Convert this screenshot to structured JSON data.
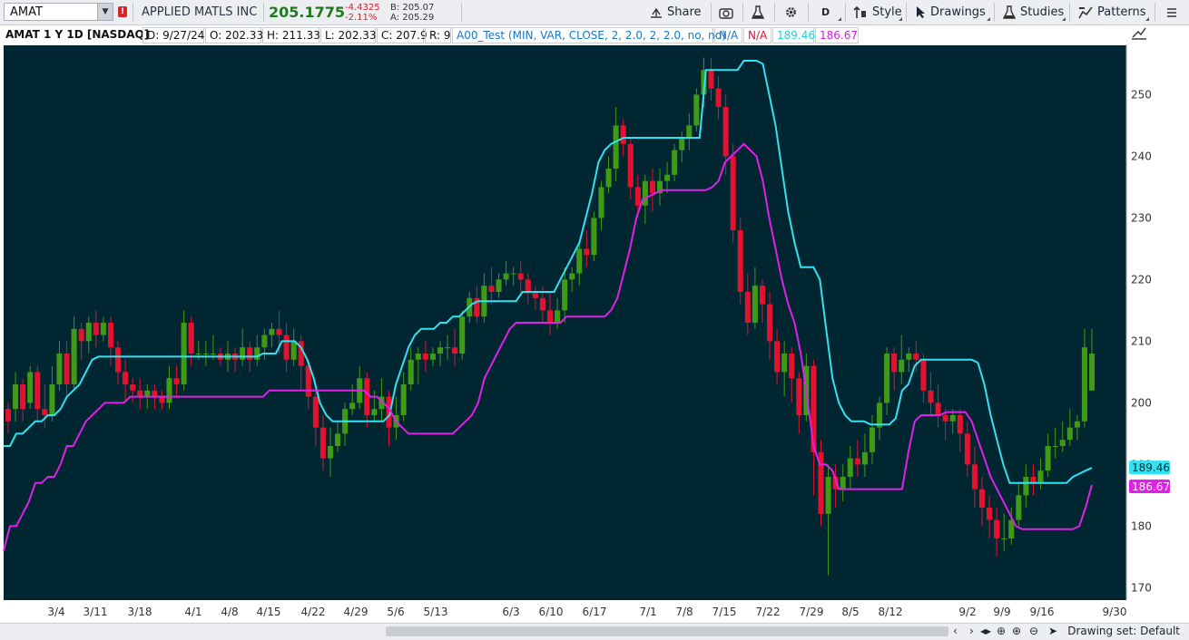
{
  "toolbar": {
    "symbol": "AMAT",
    "alert_badge": "!",
    "company": "APPLIED MATLS INC",
    "last_price": "205.1775",
    "change": "-4.4325",
    "change_pct": "-2.11%",
    "bid": "B: 205.07",
    "ask": "A: 205.29",
    "share_label": "Share",
    "aggregation_label": "D",
    "style_label": "Style",
    "drawings_label": "Drawings",
    "studies_label": "Studies",
    "patterns_label": "Patterns"
  },
  "header": {
    "title": "AMAT 1 Y 1D [NASDAQ]",
    "date": "D: 9/27/24",
    "open": "O: 202.33",
    "high": "H: 211.33",
    "low": "L: 202.33",
    "close": "C: 207.9",
    "range": "R: 9",
    "study": "A00_Test (MIN, VAR, CLOSE, 2, 2.0, 2, 2.0, no, no)",
    "val1": "N/A",
    "val2": "N/A",
    "val3": "189.46",
    "val4": "186.67"
  },
  "colors": {
    "background": "#002632",
    "up": "#3f9a16",
    "down": "#e4122f",
    "upper_line": "#33e1f0",
    "lower_line": "#e020e8",
    "axis_text": "#333333"
  },
  "chart_data": {
    "type": "candlestick",
    "ylim": [
      168,
      258
    ],
    "y_ticks": [
      170,
      180,
      190,
      200,
      210,
      220,
      230,
      240,
      250
    ],
    "x_tick_labels": [
      "3/4",
      "3/11",
      "3/18",
      "4/1",
      "4/8",
      "4/15",
      "4/22",
      "4/29",
      "5/6",
      "5/13",
      "6/3",
      "6/10",
      "6/17",
      "7/1",
      "7/8",
      "7/15",
      "7/22",
      "7/29",
      "8/5",
      "8/12",
      "9/2",
      "9/9",
      "9/16",
      "9/30"
    ],
    "price_labels": [
      189.46,
      186.67
    ],
    "upper_line": [
      193,
      193,
      195,
      195,
      196,
      197,
      197,
      198,
      198,
      199,
      201,
      202,
      203,
      205,
      207,
      207.5,
      207.5,
      207.5,
      207.5,
      207.5,
      207.5,
      207.5,
      207.5,
      207.5,
      207.5,
      207.5,
      207.5,
      207.5,
      207.5,
      207.5,
      207.5,
      207.5,
      207.5,
      207.5,
      207.5,
      207.5,
      207.5,
      207.5,
      207.5,
      207.5,
      207.5,
      208,
      208,
      208,
      210,
      210,
      210,
      209,
      207,
      204,
      200,
      198,
      197,
      197,
      197,
      197,
      197,
      197,
      197,
      197,
      197,
      198,
      203,
      206,
      209,
      211,
      212,
      212,
      212,
      213,
      213,
      214,
      214,
      215,
      216,
      216.5,
      216.5,
      216.5,
      216.5,
      216.5,
      216.5,
      216.5,
      218,
      218,
      218,
      218,
      218,
      218,
      220,
      222,
      224,
      226,
      230,
      234,
      239,
      241,
      242,
      242.5,
      243,
      243,
      243,
      243,
      243,
      243,
      243,
      243,
      243,
      243,
      243,
      243,
      243,
      254,
      254,
      254,
      254,
      254,
      254,
      255.5,
      255.5,
      255.5,
      255,
      250,
      245,
      238,
      231,
      226,
      222,
      222,
      222,
      220,
      212,
      204,
      200,
      198,
      197,
      197,
      197,
      196.5,
      196.5,
      196.5,
      196.5,
      197.5,
      202,
      203,
      206,
      207,
      207,
      207,
      207,
      207,
      207,
      207,
      207,
      207,
      206.5,
      203,
      198,
      194,
      190,
      187,
      187,
      187,
      187,
      187,
      187,
      187,
      187,
      187,
      187,
      188,
      188.5,
      189,
      189.46
    ],
    "lower_line": [
      176,
      180,
      180,
      182,
      184,
      187,
      187,
      188,
      188,
      190,
      193,
      193,
      195,
      197,
      198,
      199,
      200,
      200,
      200,
      200,
      201,
      201,
      201,
      201,
      201,
      201,
      201,
      201,
      201,
      201,
      201,
      201,
      201,
      201,
      201,
      201,
      201,
      201,
      201,
      201,
      201,
      201,
      202,
      202,
      202,
      202,
      202,
      202,
      202,
      202,
      202,
      202,
      202,
      202,
      202,
      202,
      202,
      202,
      201,
      201,
      200,
      199,
      197,
      196,
      195,
      195,
      195,
      195,
      195,
      195,
      195,
      195,
      196,
      197,
      198,
      200,
      204,
      206,
      208,
      210,
      212,
      213,
      213,
      213,
      213,
      213,
      213,
      213,
      213,
      214,
      214,
      214,
      214,
      214,
      214,
      214,
      215,
      217,
      221,
      225,
      230,
      233,
      233.5,
      234,
      234.5,
      234.5,
      234.5,
      234.5,
      234.5,
      234.5,
      234.5,
      234.5,
      235,
      236,
      239,
      240,
      241,
      242,
      241,
      240,
      236,
      230,
      225,
      220,
      216,
      213,
      208,
      201,
      193,
      190,
      190,
      189,
      186,
      186,
      186,
      186,
      186,
      186,
      186,
      186,
      186,
      186,
      186,
      192,
      197,
      198,
      198,
      198,
      198,
      198.5,
      198.5,
      198.5,
      198.5,
      197,
      194,
      191,
      188,
      186,
      184,
      182,
      180,
      179.5,
      179.5,
      179.5,
      179.5,
      179.5,
      179.5,
      179.5,
      179.5,
      179.5,
      180,
      183,
      186.67
    ],
    "candles": [
      [
        199,
        197,
        200,
        195
      ],
      [
        199,
        203,
        205,
        197
      ],
      [
        203,
        199,
        204,
        197
      ],
      [
        200,
        205,
        206,
        199
      ],
      [
        205,
        199,
        206,
        197
      ],
      [
        199,
        198,
        203,
        196
      ],
      [
        198,
        203,
        206,
        197
      ],
      [
        203,
        208,
        210,
        202
      ],
      [
        208,
        203,
        210,
        201
      ],
      [
        203,
        212,
        214,
        202
      ],
      [
        212,
        210,
        213,
        207
      ],
      [
        210,
        213,
        214,
        208
      ],
      [
        213,
        211,
        215,
        209
      ],
      [
        211,
        213,
        214,
        210
      ],
      [
        213,
        209,
        214,
        206
      ],
      [
        209,
        205,
        210,
        203
      ],
      [
        205,
        203,
        207,
        200
      ],
      [
        203,
        202,
        204,
        200
      ],
      [
        202,
        201,
        204,
        199
      ],
      [
        201,
        202,
        203,
        199
      ],
      [
        202,
        201,
        203,
        199
      ],
      [
        201,
        200,
        202,
        199
      ],
      [
        200,
        204,
        206,
        199
      ],
      [
        204,
        203,
        206,
        201
      ],
      [
        203,
        213,
        215,
        202
      ],
      [
        213,
        208,
        214,
        206
      ],
      [
        208,
        208,
        210,
        207
      ],
      [
        208,
        208,
        210,
        206
      ],
      [
        208,
        208,
        211,
        207
      ],
      [
        208,
        207,
        209,
        206
      ],
      [
        207,
        208,
        210,
        205
      ],
      [
        208,
        207,
        209,
        205
      ],
      [
        207,
        209,
        212,
        206
      ],
      [
        209,
        207,
        210,
        205
      ],
      [
        207,
        209,
        211,
        206
      ],
      [
        209,
        211,
        212,
        207
      ],
      [
        211,
        212,
        213,
        209
      ],
      [
        212,
        211,
        215,
        208
      ],
      [
        211,
        207,
        213,
        205
      ],
      [
        207,
        210,
        212,
        206
      ],
      [
        210,
        206,
        211,
        202
      ],
      [
        206,
        201,
        207,
        199
      ],
      [
        201,
        196,
        202,
        193
      ],
      [
        196,
        191,
        198,
        189
      ],
      [
        191,
        193,
        196,
        188
      ],
      [
        193,
        195,
        197,
        192
      ],
      [
        195,
        199,
        200,
        193
      ],
      [
        199,
        200,
        203,
        198
      ],
      [
        200,
        204,
        206,
        199
      ],
      [
        204,
        198,
        205,
        196
      ],
      [
        198,
        199,
        202,
        197
      ],
      [
        199,
        201,
        204,
        197
      ],
      [
        201,
        196,
        202,
        193
      ],
      [
        196,
        198,
        201,
        194
      ],
      [
        198,
        203,
        205,
        197
      ],
      [
        203,
        207,
        209,
        202
      ],
      [
        207,
        208,
        209,
        203
      ],
      [
        208,
        207,
        210,
        205
      ],
      [
        207,
        208,
        209,
        206
      ],
      [
        208,
        209,
        210,
        206
      ],
      [
        209,
        209,
        211,
        207
      ],
      [
        209,
        208,
        212,
        206
      ],
      [
        208,
        214,
        215,
        207
      ],
      [
        214,
        217,
        218,
        213
      ],
      [
        217,
        214,
        219,
        213
      ],
      [
        214,
        219,
        221,
        213
      ],
      [
        219,
        218,
        222,
        216
      ],
      [
        218,
        220,
        221,
        217
      ],
      [
        220,
        221,
        223,
        219
      ],
      [
        221,
        221,
        222,
        219
      ],
      [
        221,
        220,
        223,
        218
      ],
      [
        220,
        218,
        221,
        216
      ],
      [
        218,
        217,
        219,
        215
      ],
      [
        217,
        215,
        219,
        213
      ],
      [
        215,
        213,
        218,
        211
      ],
      [
        213,
        215,
        217,
        212
      ],
      [
        215,
        220,
        222,
        213
      ],
      [
        220,
        221,
        222,
        218
      ],
      [
        221,
        225,
        226,
        219
      ],
      [
        225,
        224,
        228,
        222
      ],
      [
        224,
        230,
        231,
        223
      ],
      [
        230,
        235,
        236,
        228
      ],
      [
        235,
        238,
        240,
        234
      ],
      [
        238,
        245,
        248,
        236
      ],
      [
        245,
        242,
        246,
        240
      ],
      [
        242,
        235,
        243,
        233
      ],
      [
        235,
        232,
        237,
        230
      ],
      [
        232,
        236,
        237,
        229
      ],
      [
        236,
        234,
        238,
        231
      ],
      [
        234,
        236,
        238,
        232
      ],
      [
        236,
        237,
        239,
        234
      ],
      [
        237,
        241,
        242,
        236
      ],
      [
        241,
        243,
        244,
        239
      ],
      [
        243,
        245,
        247,
        241
      ],
      [
        245,
        250,
        251,
        244
      ],
      [
        250,
        254,
        256,
        248
      ],
      [
        254,
        251,
        256,
        249
      ],
      [
        251,
        248,
        253,
        246
      ],
      [
        248,
        240,
        250,
        237
      ],
      [
        240,
        228,
        242,
        226
      ],
      [
        228,
        218,
        230,
        216
      ],
      [
        218,
        213,
        221,
        211
      ],
      [
        213,
        219,
        222,
        212
      ],
      [
        219,
        216,
        220,
        213
      ],
      [
        216,
        210,
        218,
        207
      ],
      [
        210,
        205,
        212,
        203
      ],
      [
        205,
        208,
        210,
        201
      ],
      [
        208,
        204,
        209,
        200
      ],
      [
        204,
        198,
        205,
        195
      ],
      [
        198,
        206,
        208,
        197
      ],
      [
        206,
        192,
        207,
        185
      ],
      [
        192,
        182,
        194,
        180
      ],
      [
        182,
        188,
        190,
        172
      ],
      [
        188,
        186,
        190,
        183
      ],
      [
        186,
        188,
        190,
        184
      ],
      [
        188,
        191,
        193,
        186
      ],
      [
        191,
        190,
        194,
        188
      ],
      [
        190,
        192,
        195,
        188
      ],
      [
        192,
        196,
        198,
        190
      ],
      [
        196,
        200,
        201,
        194
      ],
      [
        200,
        208,
        209,
        198
      ],
      [
        208,
        205,
        209,
        202
      ],
      [
        205,
        207,
        211,
        203
      ],
      [
        207,
        208,
        209,
        205
      ],
      [
        208,
        207,
        210,
        205
      ],
      [
        207,
        202,
        208,
        200
      ],
      [
        202,
        200,
        205,
        198
      ],
      [
        200,
        198,
        203,
        196
      ],
      [
        198,
        197,
        199,
        194
      ],
      [
        197,
        198,
        199,
        195
      ],
      [
        198,
        195,
        199,
        192
      ],
      [
        195,
        190,
        197,
        188
      ],
      [
        190,
        186,
        193,
        183
      ],
      [
        186,
        183,
        188,
        180
      ],
      [
        183,
        181,
        185,
        178
      ],
      [
        181,
        178,
        183,
        175
      ],
      [
        178,
        178,
        182,
        176
      ],
      [
        178,
        181,
        183,
        177
      ],
      [
        181,
        185,
        187,
        180
      ],
      [
        185,
        188,
        190,
        183
      ],
      [
        188,
        187,
        190,
        185
      ],
      [
        187,
        189,
        191,
        186
      ],
      [
        189,
        193,
        195,
        188
      ],
      [
        193,
        193,
        196,
        191
      ],
      [
        193,
        194,
        197,
        192
      ],
      [
        194,
        196,
        199,
        193
      ],
      [
        196,
        197,
        198,
        194
      ],
      [
        197,
        209,
        212,
        196
      ],
      [
        202,
        208,
        212,
        202
      ]
    ]
  },
  "scrollbar": {
    "drawing_set": "Drawing set: Default"
  }
}
